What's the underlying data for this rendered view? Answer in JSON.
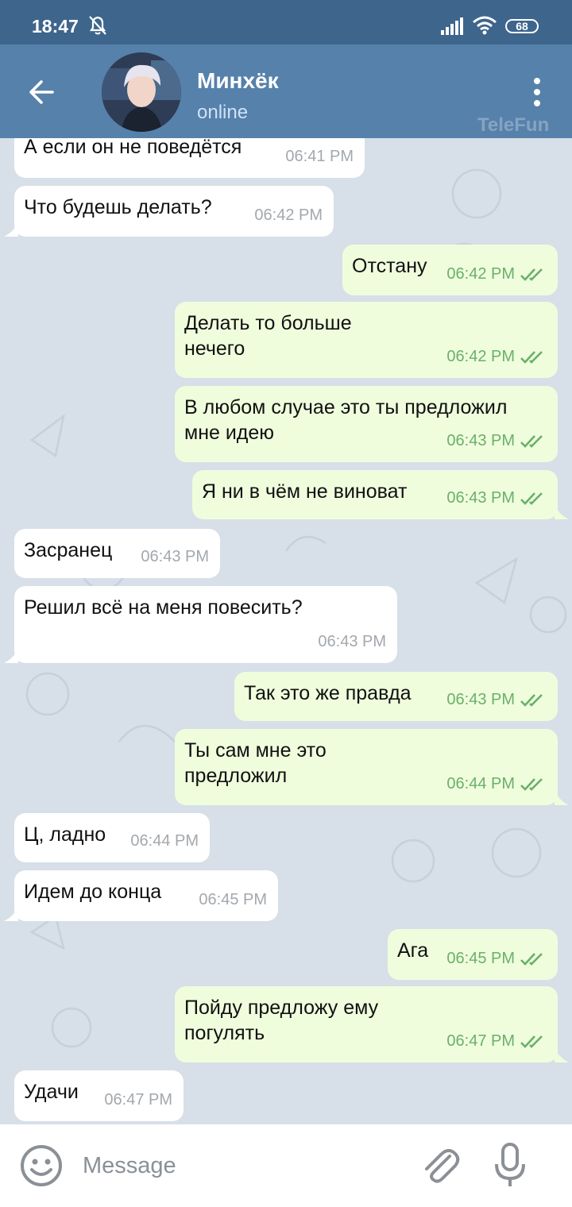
{
  "status": {
    "time": "18:47",
    "battery": "68"
  },
  "header": {
    "contact_name": "Минхёк",
    "presence": "online",
    "watermark": "TeleFun"
  },
  "messages": [
    {
      "text": "А если он не поведётся",
      "time": "06:41 PM",
      "dir": "in"
    },
    {
      "text": "Что будешь делать?",
      "time": "06:42 PM",
      "dir": "in"
    },
    {
      "text": "Отстану",
      "time": "06:42 PM",
      "dir": "out"
    },
    {
      "text": "Делать то больше\nнечего",
      "time": "06:42 PM",
      "dir": "out"
    },
    {
      "text": "В любом случае это ты предложил\nмне идею",
      "time": "06:43 PM",
      "dir": "out"
    },
    {
      "text": "Я ни в чём не виноват",
      "time": "06:43 PM",
      "dir": "out"
    },
    {
      "text": "Засранец",
      "time": "06:43 PM",
      "dir": "in"
    },
    {
      "text": "Решил всё на меня повесить?",
      "time": "06:43 PM",
      "dir": "in"
    },
    {
      "text": "Так это же правда",
      "time": "06:43 PM",
      "dir": "out"
    },
    {
      "text": "Ты сам мне это\nпредложил",
      "time": "06:44 PM",
      "dir": "out"
    },
    {
      "text": "Ц, ладно",
      "time": "06:44 PM",
      "dir": "in"
    },
    {
      "text": "Идем до конца",
      "time": "06:45 PM",
      "dir": "in"
    },
    {
      "text": "Ага",
      "time": "06:45 PM",
      "dir": "out"
    },
    {
      "text": "Пойду предложу ему\nпогулять",
      "time": "06:47 PM",
      "dir": "out"
    },
    {
      "text": "Удачи",
      "time": "06:47 PM",
      "dir": "in"
    }
  ],
  "composer": {
    "placeholder": "Message"
  },
  "colors": {
    "header": "#5681ab",
    "statusbar": "#3e658c",
    "incoming": "#ffffff",
    "outgoing": "#effddd",
    "read_ticks": "#6ab06a"
  },
  "icons": [
    "back-arrow-icon",
    "more-vertical-icon",
    "emoji-icon",
    "attach-icon",
    "microphone-icon",
    "double-check-icon",
    "muted-bell-icon",
    "signal-icon",
    "wifi-icon"
  ]
}
